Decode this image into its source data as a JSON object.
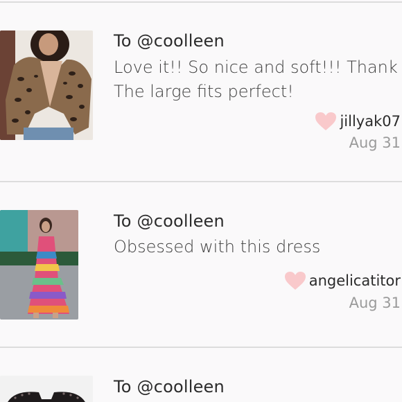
{
  "comments": [
    {
      "to": "To @coolleen",
      "message_lines": [
        "Love it!! So nice and soft!!! Thank y",
        "The large fits perfect!"
      ],
      "author": "jillyak07",
      "date": "Aug 31",
      "thumbnail": "leopard-coat-photo"
    },
    {
      "to": "To @coolleen",
      "message_lines": [
        "Obsessed with this dress"
      ],
      "author": "angelicatitor",
      "date": "Aug 31",
      "thumbnail": "striped-dress-photo"
    },
    {
      "to": "To @coolleen",
      "message_lines": [],
      "author": "",
      "date": "",
      "thumbnail": "sunglasses-photo"
    }
  ],
  "icons": {
    "like": "heart-icon"
  },
  "colors": {
    "heart": "#f9c9cb",
    "divider": "#dcdcdc",
    "date": "#9a9a9a",
    "text": "#2b2b2b"
  }
}
